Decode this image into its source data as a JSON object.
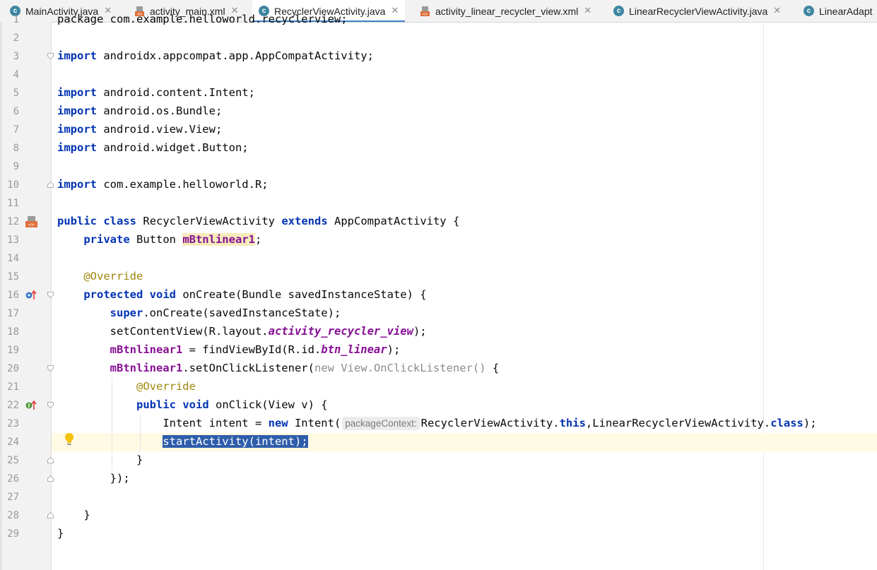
{
  "tabs": [
    {
      "label": "MainActivity.java",
      "type": "java",
      "active": false
    },
    {
      "label": "activity_main.xml",
      "type": "xml",
      "active": false
    },
    {
      "label": "RecyclerViewActivity.java",
      "type": "java",
      "active": true
    },
    {
      "label": "activity_linear_recycler_view.xml",
      "type": "xml",
      "active": false
    },
    {
      "label": "LinearRecyclerViewActivity.java",
      "type": "java",
      "active": false
    },
    {
      "label": "LinearAdapt",
      "type": "java",
      "active": false
    }
  ],
  "tab_close_glyph": "✕",
  "java_icon_letter": "c",
  "line_numbers": [
    "1",
    "2",
    "3",
    "4",
    "5",
    "6",
    "7",
    "8",
    "9",
    "10",
    "11",
    "12",
    "13",
    "14",
    "15",
    "16",
    "17",
    "18",
    "19",
    "20",
    "21",
    "22",
    "23",
    "24",
    "25",
    "26",
    "27",
    "28",
    "29"
  ],
  "code": {
    "l1": "package com.example.helloworld.recyclerview;",
    "l3_kw": "import",
    "l3": " androidx.appcompat.app.AppCompatActivity;",
    "l5_kw": "import",
    "l5": " android.content.Intent;",
    "l6_kw": "import",
    "l6": " android.os.Bundle;",
    "l7_kw": "import",
    "l7": " android.view.View;",
    "l8_kw": "import",
    "l8": " android.widget.Button;",
    "l10_kw": "import",
    "l10": " com.example.helloworld.R;",
    "l12_kw1": "public",
    "l12_kw2": "class",
    "l12_name": "RecyclerViewActivity",
    "l12_kw3": "extends",
    "l12_rest": " AppCompatActivity {",
    "l13_kw": "private",
    "l13_type": " Button ",
    "l13_field": "mBtnlinear1",
    "l13_end": ";",
    "l15_ann": "@Override",
    "l16_kw1": "protected",
    "l16_kw2": "void",
    "l16_rest": " onCreate(Bundle savedInstanceState) {",
    "l17_kw": "super",
    "l17_rest": ".onCreate(savedInstanceState);",
    "l18_a": "setContentView(R.layout.",
    "l18_static": "activity_recycler_view",
    "l18_b": ");",
    "l19_field": "mBtnlinear1",
    "l19_a": " = findViewById(R.id.",
    "l19_static": "btn_linear",
    "l19_b": ");",
    "l20_field": "mBtnlinear1",
    "l20_a": ".setOnClickListener(",
    "l20_gray": "new View.OnClickListener()",
    "l20_b": " {",
    "l21_ann": "@Override",
    "l22_kw1": "public",
    "l22_kw2": "void",
    "l22_rest": " onClick(View v) {",
    "l23_a": "Intent intent = ",
    "l23_kw": "new",
    "l23_b": " Intent(",
    "l23_hint": "packageContext:",
    "l23_c": "RecyclerViewActivity.",
    "l23_kw2": "this",
    "l23_d": ",LinearRecyclerViewActivity.",
    "l23_kw3": "class",
    "l23_e": ");",
    "l24_sel": "startActivity(intent);",
    "l25": "}",
    "l26": "});",
    "l28": "}",
    "l29": "}"
  },
  "colors": {
    "keyword": "#0033b3",
    "field": "#871094",
    "annotation": "#9e880d",
    "selection": "#214283",
    "caret_row": "#fffae3"
  }
}
